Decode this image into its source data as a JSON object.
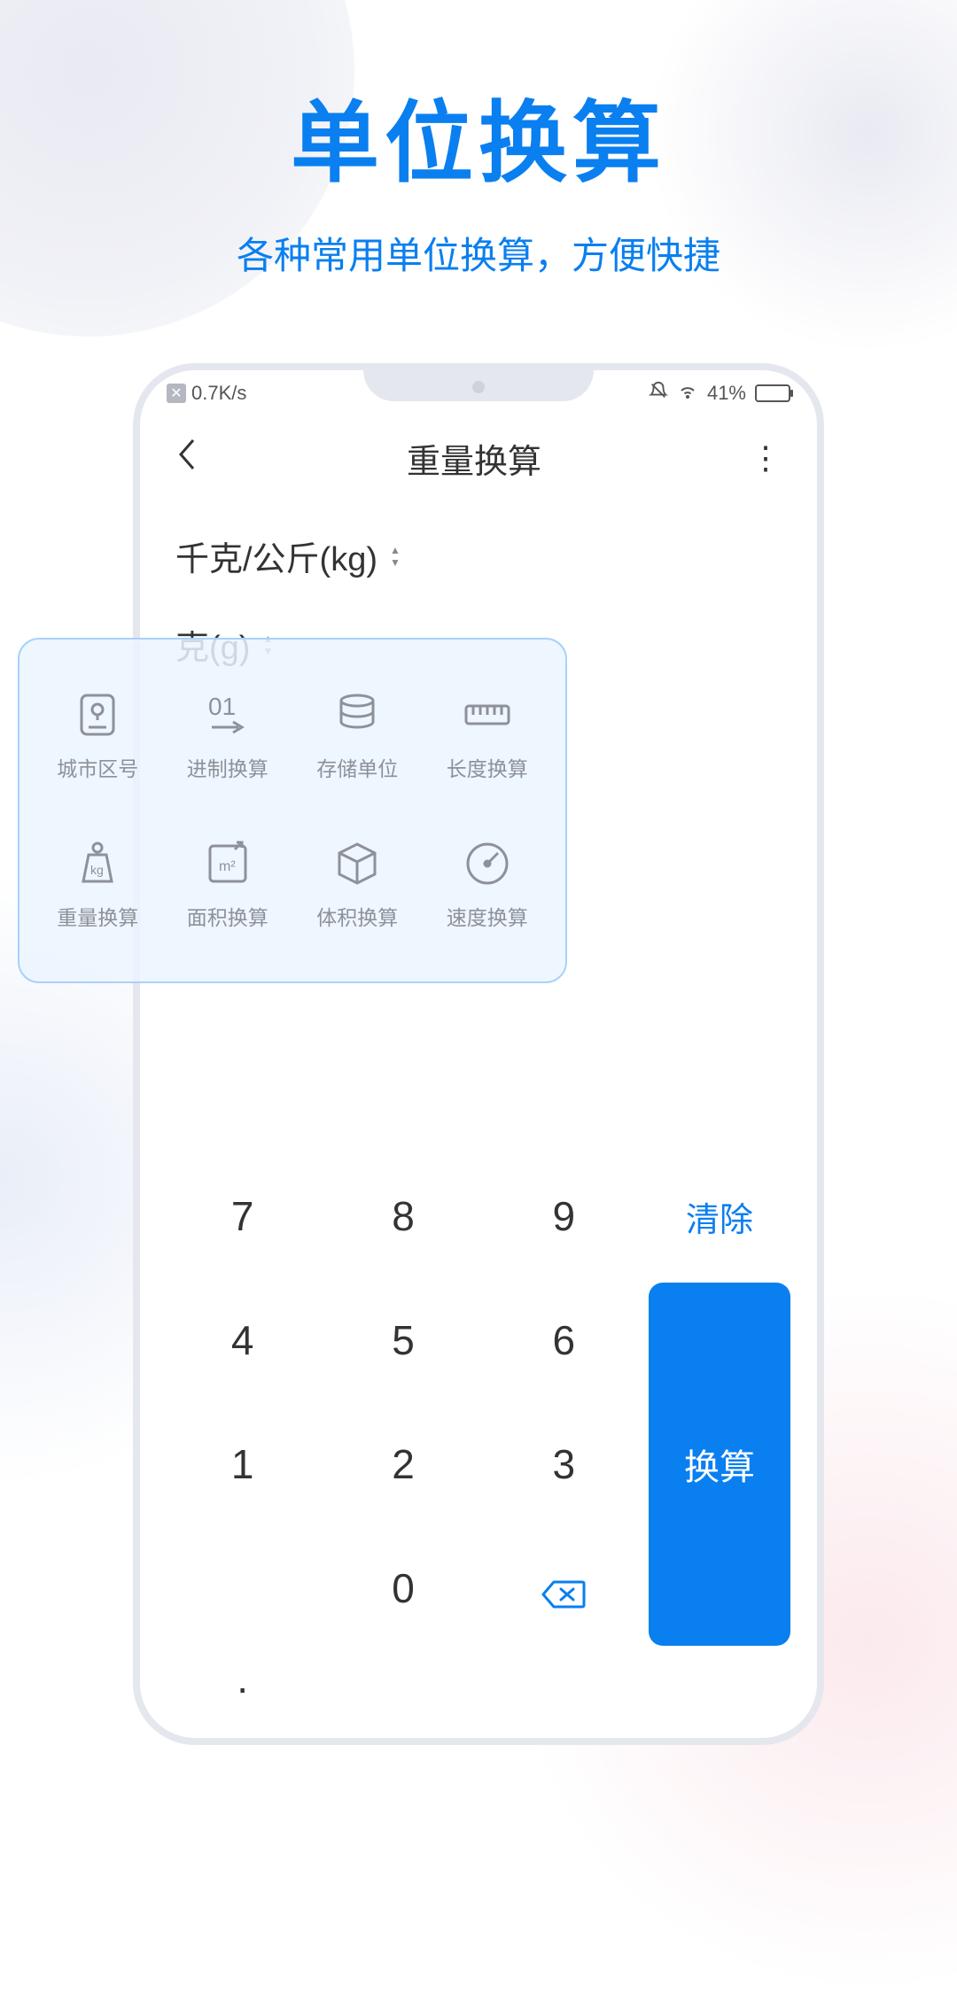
{
  "promo": {
    "title": "单位换算",
    "subtitle": "各种常用单位换算，方便快捷"
  },
  "statusbar": {
    "net_speed": "0.7K/s",
    "battery_pct": "41%"
  },
  "appbar": {
    "title": "重量换算"
  },
  "units": {
    "from": "千克/公斤(kg)",
    "to": "克(g)"
  },
  "keypad": {
    "k7": "7",
    "k8": "8",
    "k9": "9",
    "k4": "4",
    "k5": "5",
    "k6": "6",
    "k1": "1",
    "k2": "2",
    "k3": "3",
    "k0": "0",
    "dot": ".",
    "clear": "清除",
    "convert": "换算"
  },
  "overlay": {
    "items": [
      {
        "label": "城市区号",
        "name": "city-code"
      },
      {
        "label": "进制换算",
        "name": "radix-convert"
      },
      {
        "label": "存储单位",
        "name": "storage-unit"
      },
      {
        "label": "长度换算",
        "name": "length-convert"
      },
      {
        "label": "重量换算",
        "name": "weight-convert"
      },
      {
        "label": "面积换算",
        "name": "area-convert"
      },
      {
        "label": "体积换算",
        "name": "volume-convert"
      },
      {
        "label": "速度换算",
        "name": "speed-convert"
      }
    ]
  }
}
